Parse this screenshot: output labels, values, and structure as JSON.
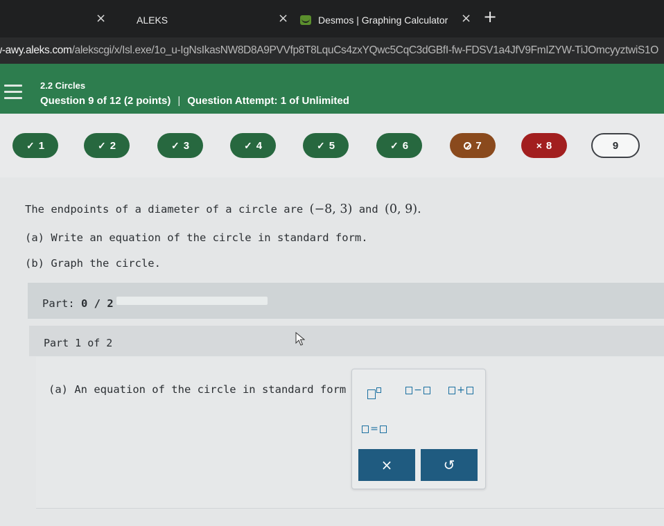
{
  "browser": {
    "tabs": [
      {
        "title": "ALEKS",
        "close": "×"
      },
      {
        "title": "Desmos | Graphing Calculator",
        "close": "×"
      }
    ],
    "first_tab_close": "×",
    "new_tab": "+",
    "url_host": "w-awy.aleks.com",
    "url_path": "/alekscgi/x/Isl.exe/1o_u-IgNsIkasNW8D8A9PVVfp8T8LquCs4zxYQwc5CqC3dGBfI-fw-FDSV1a4JfV9FmIZYW-TiJOmcyyztwiS1O"
  },
  "header": {
    "section": "2.2 Circles",
    "question": "Question 9 of 12 (2 points)",
    "separator": "|",
    "attempt": "Question Attempt: 1 of Unlimited"
  },
  "question_nav": [
    {
      "number": "1",
      "status": "correct",
      "mark": "✓"
    },
    {
      "number": "2",
      "status": "correct",
      "mark": "✓"
    },
    {
      "number": "3",
      "status": "correct",
      "mark": "✓"
    },
    {
      "number": "4",
      "status": "correct",
      "mark": "✓"
    },
    {
      "number": "5",
      "status": "correct",
      "mark": "✓"
    },
    {
      "number": "6",
      "status": "correct",
      "mark": "✓"
    },
    {
      "number": "7",
      "status": "partial",
      "mark": ""
    },
    {
      "number": "8",
      "status": "incorrect",
      "mark": "×"
    },
    {
      "number": "9",
      "status": "current",
      "mark": ""
    }
  ],
  "problem": {
    "line1_prefix": "The endpoints of a diameter of a circle are",
    "point1": "(−8, 3)",
    "and_word": "and",
    "point2": "(0, 9).",
    "part_a": "(a) Write an equation of the circle in standard form.",
    "part_b": "(b) Graph the circle."
  },
  "progress": {
    "label": "Part:",
    "value": "0 / 2",
    "fraction": 0
  },
  "part_header": "Part 1 of 2",
  "answer": {
    "prompt": "(a) An equation of the circle in standard form is",
    "period": "."
  },
  "palette": {
    "exponent": "exponent",
    "minus_op": "−",
    "plus_op": "+",
    "equals_op": "=",
    "clear_label": "×",
    "undo_label": "↺"
  },
  "colors": {
    "header_green": "#2d7d4e",
    "correct": "#27683f",
    "partial": "#8a4a1d",
    "incorrect": "#a21f1f",
    "action_blue": "#1f5b80"
  }
}
